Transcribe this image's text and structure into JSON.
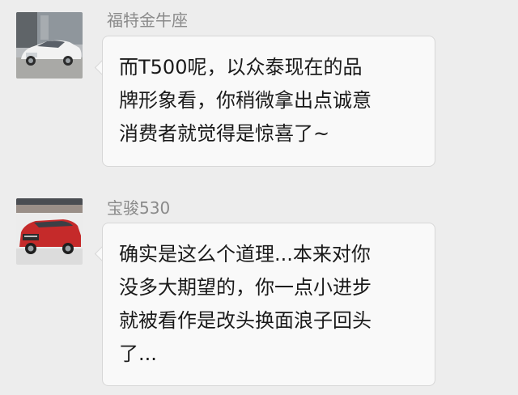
{
  "messages": [
    {
      "sender": "福特金牛座",
      "avatar_icon": "white-sedan-car-photo",
      "text": "而T500呢，以众泰现在的品\n牌形象看，你稍微拿出点诚意\n消费者就觉得是惊喜了~"
    },
    {
      "sender": "宝骏530",
      "avatar_icon": "red-suv-car-photo",
      "text": "确实是这么个道理...本来对你\n没多大期望的，你一点小进步\n就被看作是改头换面浪子回头\n了..."
    }
  ]
}
